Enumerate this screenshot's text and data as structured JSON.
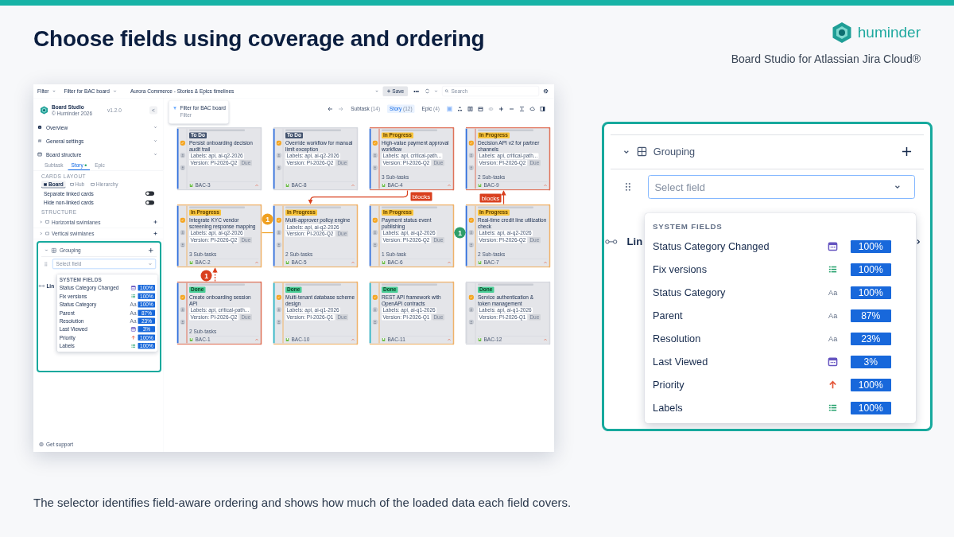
{
  "slide": {
    "title": "Choose fields using coverage and ordering",
    "brand": "huminder",
    "tagline": "Board Studio for Atlassian Jira Cloud®",
    "caption": "The selector identifies field-aware ordering and shows how much of the loaded data each field covers."
  },
  "app": {
    "topbar": {
      "filters": [
        "Filter",
        "Filter for BAC board"
      ],
      "board_name": "Aurora Commerce - Stories & Epics timelines",
      "save": "Save",
      "more": "•••",
      "search": {
        "placeholder": "Search"
      }
    },
    "sidebar": {
      "app_name": "Board Studio",
      "copyright": "© Huminder 2026",
      "version": "v1.2.0",
      "collapse": "<",
      "sections": [
        {
          "label": "Overview",
          "kind": "info"
        },
        {
          "label": "General settings",
          "kind": "settings"
        },
        {
          "label": "Board structure",
          "kind": "board"
        }
      ],
      "tabs": [
        {
          "label": "Subtask",
          "selected": false
        },
        {
          "label": "Story",
          "selected": true
        },
        {
          "label": "Epic",
          "selected": false
        }
      ],
      "cards_layout": {
        "heading": "CARDS LAYOUT",
        "options": [
          {
            "label": "Board",
            "selected": true
          },
          {
            "label": "Hub",
            "selected": false
          },
          {
            "label": "Hierarchy",
            "selected": false
          }
        ]
      },
      "toggles": [
        {
          "label": "Separate linked cards",
          "on": false
        },
        {
          "label": "Hide non-linked cards",
          "on": false
        }
      ],
      "structure": {
        "heading": "STRUCTURE",
        "items": [
          {
            "label": "Horizontal swimlanes"
          },
          {
            "label": "Vertical swimlanes"
          }
        ]
      },
      "grouping": {
        "label": "Grouping",
        "select": {
          "placeholder": "Select field"
        },
        "behind": "Lin",
        "dropdown": {
          "heading": "SYSTEM FIELDS",
          "fields": [
            {
              "name": "Status Category Changed",
              "kind": "date",
              "coverage": "100%"
            },
            {
              "name": "Fix versions",
              "kind": "list",
              "coverage": "100%"
            },
            {
              "name": "Status Category",
              "kind": "text",
              "icon": "Aa",
              "coverage": "100%"
            },
            {
              "name": "Parent",
              "kind": "text",
              "icon": "Aa",
              "coverage": "87%"
            },
            {
              "name": "Resolution",
              "kind": "text",
              "icon": "Aa",
              "coverage": "23%"
            },
            {
              "name": "Last Viewed",
              "kind": "date",
              "coverage": "3%"
            },
            {
              "name": "Priority",
              "kind": "priority",
              "coverage": "100%"
            },
            {
              "name": "Labels",
              "kind": "list",
              "coverage": "100%"
            }
          ]
        }
      },
      "support": "Get support"
    },
    "filter_card": {
      "title": "Filter for BAC board",
      "subtitle": "Filter"
    },
    "issue_types": [
      {
        "label": "Subtask",
        "count": "(14)",
        "selected": false
      },
      {
        "label": "Story",
        "count": "(12)",
        "selected": true
      },
      {
        "label": "Epic",
        "count": "(4)",
        "selected": false
      }
    ],
    "cards": [
      {
        "key": "BAC-3",
        "status": "To Do",
        "kind": "todo",
        "title": "Persist onboarding decision audit trail",
        "chips": [
          "Labels: api, ai-q2-2026",
          "Version: PI-2026-Q2",
          "Due"
        ],
        "color": "#d5d8de",
        "accent": {
          "color": "#2f6fde"
        }
      },
      {
        "key": "BAC-8",
        "status": "To Do",
        "kind": "todo",
        "title": "Override workflow for manual limit exception",
        "chips": [
          "Labels: api, ai-q2-2026",
          "Version: PI-2026-Q2",
          "Due"
        ],
        "color": "#d5d8de",
        "accent": {
          "color": "#2f6fde"
        }
      },
      {
        "key": "BAC-4",
        "status": "In Progress",
        "kind": "progress",
        "title": "High-value payment approval workflow",
        "chips": [
          "Labels: api, critical-path...",
          "Version: PI-2026-Q2",
          "Due"
        ],
        "subtasks": "3 Sub-tasks",
        "color": "#e0735a",
        "accent": {
          "color": "#2f6fde"
        }
      },
      {
        "key": "BAC-9",
        "status": "In Progress",
        "kind": "progress",
        "title": "Decision API v2 for partner channels",
        "chips": [
          "Labels: api, critical-path...",
          "Version: PI-2026-Q2",
          "Due"
        ],
        "subtasks": "2 Sub-tasks",
        "color": "#e0735a",
        "accent": {
          "color": "#2f6fde"
        }
      },
      {
        "key": "BAC-2",
        "status": "In Progress",
        "kind": "progress",
        "title": "Integrate KYC vendor screening response mapping",
        "chips": [
          "Labels: api, ai-q2-2026",
          "Version: PI-2026-Q2",
          "Due"
        ],
        "subtasks": "3 Sub-tasks",
        "color": "#f0b36b",
        "accent": {
          "color": "#2f6fde"
        }
      },
      {
        "key": "BAC-5",
        "status": "In Progress",
        "kind": "progress",
        "title": "Multi-approver policy engine",
        "chips": [
          "Labels: api, ai-q2-2026",
          "Version: PI-2026-Q2",
          "Due"
        ],
        "subtasks": "2 Sub-tasks",
        "color": "#f0b36b",
        "accent": {
          "color": "#2f6fde"
        }
      },
      {
        "key": "BAC-6",
        "status": "In Progress",
        "kind": "progress",
        "title": "Payment status event publishing",
        "chips": [
          "Labels: api, ai-q2-2026",
          "Version: PI-2026-Q2",
          "Due"
        ],
        "subtasks": "1 Sub-task",
        "color": "#f0b36b",
        "accent": {
          "color": "#2f6fde"
        }
      },
      {
        "key": "BAC-7",
        "status": "In Progress",
        "kind": "progress",
        "title": "Real-time credit line utilization check",
        "chips": [
          "Labels: api, ai-q2-2026",
          "Version: PI-2026-Q2",
          "Due"
        ],
        "subtasks": "2 Sub-tasks",
        "color": "#f0b36b",
        "accent": {
          "color": "#2f6fde"
        }
      },
      {
        "key": "BAC-1",
        "status": "Done",
        "kind": "done",
        "title": "Create onboarding session API",
        "chips": [
          "Labels: api, critical-path...",
          "Version: PI-2026-Q2",
          "Due"
        ],
        "subtasks": "2 Sub-tasks",
        "color": "#e0735a",
        "accent": {
          "color": "#2f6fde"
        }
      },
      {
        "key": "BAC-10",
        "status": "Done",
        "kind": "done",
        "title": "Multi-tenant database scheme design",
        "chips": [
          "Labels: api, ai-q1-2026",
          "Version: PI-2026-Q1",
          "Due"
        ],
        "color": "#f0b36b",
        "accent": {
          "color": "#2bb5c6"
        }
      },
      {
        "key": "BAC-11",
        "status": "Done",
        "kind": "done",
        "title": "REST API framework with OpenAPI contracts",
        "chips": [
          "Labels: api, ai-q1-2026",
          "Version: PI-2026-Q1",
          "Due"
        ],
        "color": "#f0b36b",
        "accent": {
          "color": "#2bb5c6"
        }
      },
      {
        "key": "BAC-12",
        "status": "Done",
        "kind": "done",
        "title": "Service authentication & token management",
        "chips": [
          "Labels: api, ai-q1-2026",
          "Version: PI-2026-Q1",
          "Due"
        ],
        "color": "#d5d8de",
        "accent": {
          "color": "#d5d8de"
        }
      }
    ],
    "links": [
      {
        "kind": "blocks",
        "label": "blocks",
        "color": "#d9401f"
      },
      {
        "kind": "blocks",
        "label": "blocks",
        "color": "#d9401f"
      },
      {
        "kind": "relates",
        "label": "1",
        "color": "#f0a020"
      },
      {
        "kind": "relates",
        "label": "1",
        "color": "#2e9e6a"
      },
      {
        "kind": "relates",
        "label": "1",
        "color": "#d9401f"
      }
    ]
  },
  "zoom_panel": {
    "grouping": {
      "label": "Grouping",
      "select": {
        "placeholder": "Select field"
      },
      "behind": "Lin",
      "dropdown": {
        "heading": "SYSTEM FIELDS",
        "fields": [
          {
            "name": "Status Category Changed",
            "kind": "date",
            "coverage": "100%"
          },
          {
            "name": "Fix versions",
            "kind": "list",
            "coverage": "100%"
          },
          {
            "name": "Status Category",
            "kind": "text",
            "icon": "Aa",
            "coverage": "100%"
          },
          {
            "name": "Parent",
            "kind": "text",
            "icon": "Aa",
            "coverage": "87%"
          },
          {
            "name": "Resolution",
            "kind": "text",
            "icon": "Aa",
            "coverage": "23%"
          },
          {
            "name": "Last Viewed",
            "kind": "date",
            "coverage": "3%"
          },
          {
            "name": "Priority",
            "kind": "priority",
            "coverage": "100%"
          },
          {
            "name": "Labels",
            "kind": "list",
            "coverage": "100%"
          }
        ]
      }
    }
  }
}
